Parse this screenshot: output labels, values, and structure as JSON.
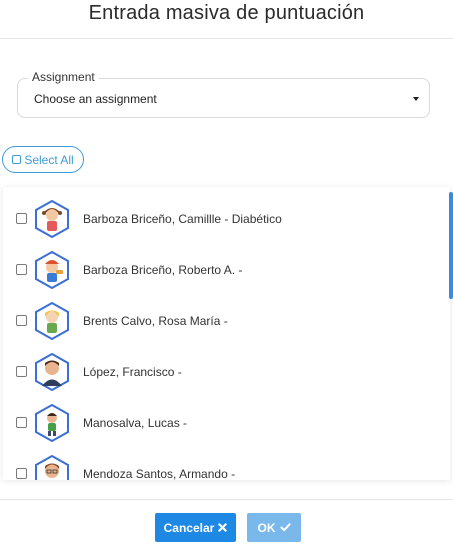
{
  "dialog": {
    "title": "Entrada masiva de puntuación"
  },
  "assignment": {
    "label": "Assignment",
    "value": "Choose an assignment",
    "caret_icon": "caret-down-icon"
  },
  "select_all": {
    "label": "Select All",
    "icon": "square-icon"
  },
  "students": [
    {
      "name": "Barboza Briceño, Camillle - Diabético",
      "avatar": "girl-avatar"
    },
    {
      "name": "Barboza Briceño, Roberto A. -",
      "avatar": "boy-cap-avatar"
    },
    {
      "name": "Brents Calvo, Rosa María -",
      "avatar": "girl-blonde-avatar"
    },
    {
      "name": "López, Francisco -",
      "avatar": "man-avatar"
    },
    {
      "name": "Manosalva, Lucas -",
      "avatar": "boy-avatar"
    },
    {
      "name": "Mendoza Santos, Armando -",
      "avatar": "man-glasses-avatar"
    }
  ],
  "footer": {
    "cancel_label": "Cancelar",
    "cancel_icon": "close-icon",
    "ok_label": "OK",
    "ok_icon": "check-icon"
  },
  "colors": {
    "accent": "#1e88e5",
    "ok_disabled": "#7ab8ec",
    "outline": "#3d9cd8"
  }
}
